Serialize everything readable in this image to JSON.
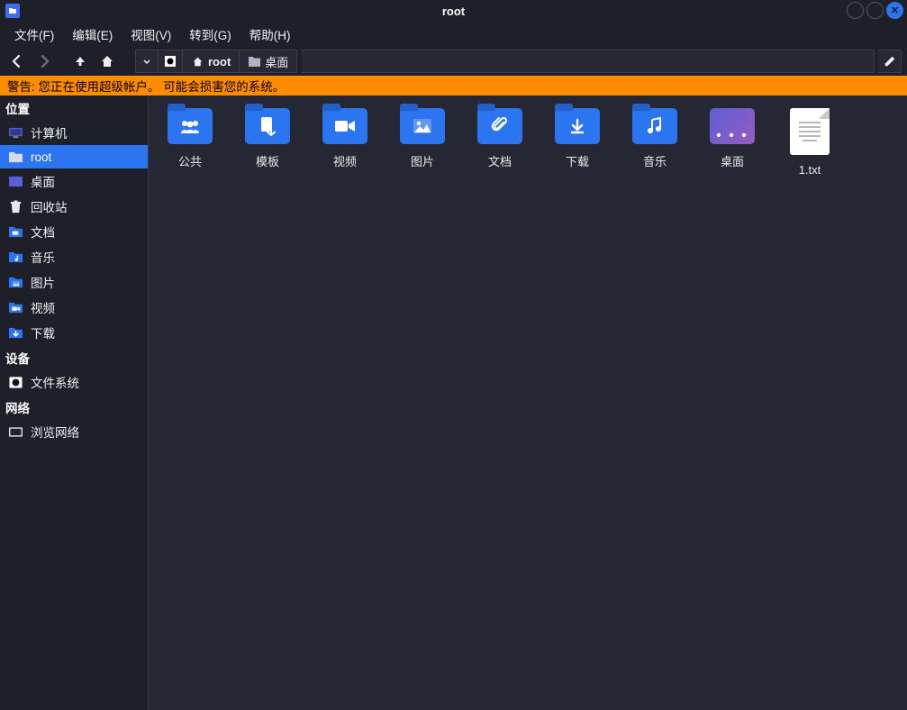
{
  "window": {
    "title": "root"
  },
  "menus": {
    "file": "文件(F)",
    "edit": "编辑(E)",
    "view": "视图(V)",
    "go": "转到(G)",
    "help": "帮助(H)"
  },
  "pathbar": {
    "root": "root",
    "desktop": "桌面"
  },
  "warning": "警告: 您正在使用超级帐户。 可能会损害您的系统。",
  "sidebar": {
    "hdr_places": "位置",
    "hdr_devices": "设备",
    "hdr_network": "网络",
    "places": [
      {
        "label": "计算机",
        "icon": "monitor"
      },
      {
        "label": "root",
        "icon": "folder-gray",
        "selected": true
      },
      {
        "label": "桌面",
        "icon": "desktop"
      },
      {
        "label": "回收站",
        "icon": "trash"
      },
      {
        "label": "文档",
        "icon": "docs"
      },
      {
        "label": "音乐",
        "icon": "music"
      },
      {
        "label": "图片",
        "icon": "pictures"
      },
      {
        "label": "视频",
        "icon": "videos"
      },
      {
        "label": "下载",
        "icon": "downloads"
      }
    ],
    "devices": [
      {
        "label": "文件系统",
        "icon": "fs"
      }
    ],
    "network": [
      {
        "label": "浏览网络",
        "icon": "net"
      }
    ]
  },
  "files": [
    {
      "label": "公共",
      "type": "folder",
      "glyph": "people"
    },
    {
      "label": "模板",
      "type": "folder",
      "glyph": "template"
    },
    {
      "label": "视频",
      "type": "folder",
      "glyph": "video"
    },
    {
      "label": "图片",
      "type": "folder",
      "glyph": "image"
    },
    {
      "label": "文档",
      "type": "folder",
      "glyph": "clip"
    },
    {
      "label": "下载",
      "type": "folder",
      "glyph": "download"
    },
    {
      "label": "音乐",
      "type": "folder",
      "glyph": "music"
    },
    {
      "label": "桌面",
      "type": "desktop",
      "glyph": "dots"
    },
    {
      "label": "1.txt",
      "type": "file"
    }
  ]
}
